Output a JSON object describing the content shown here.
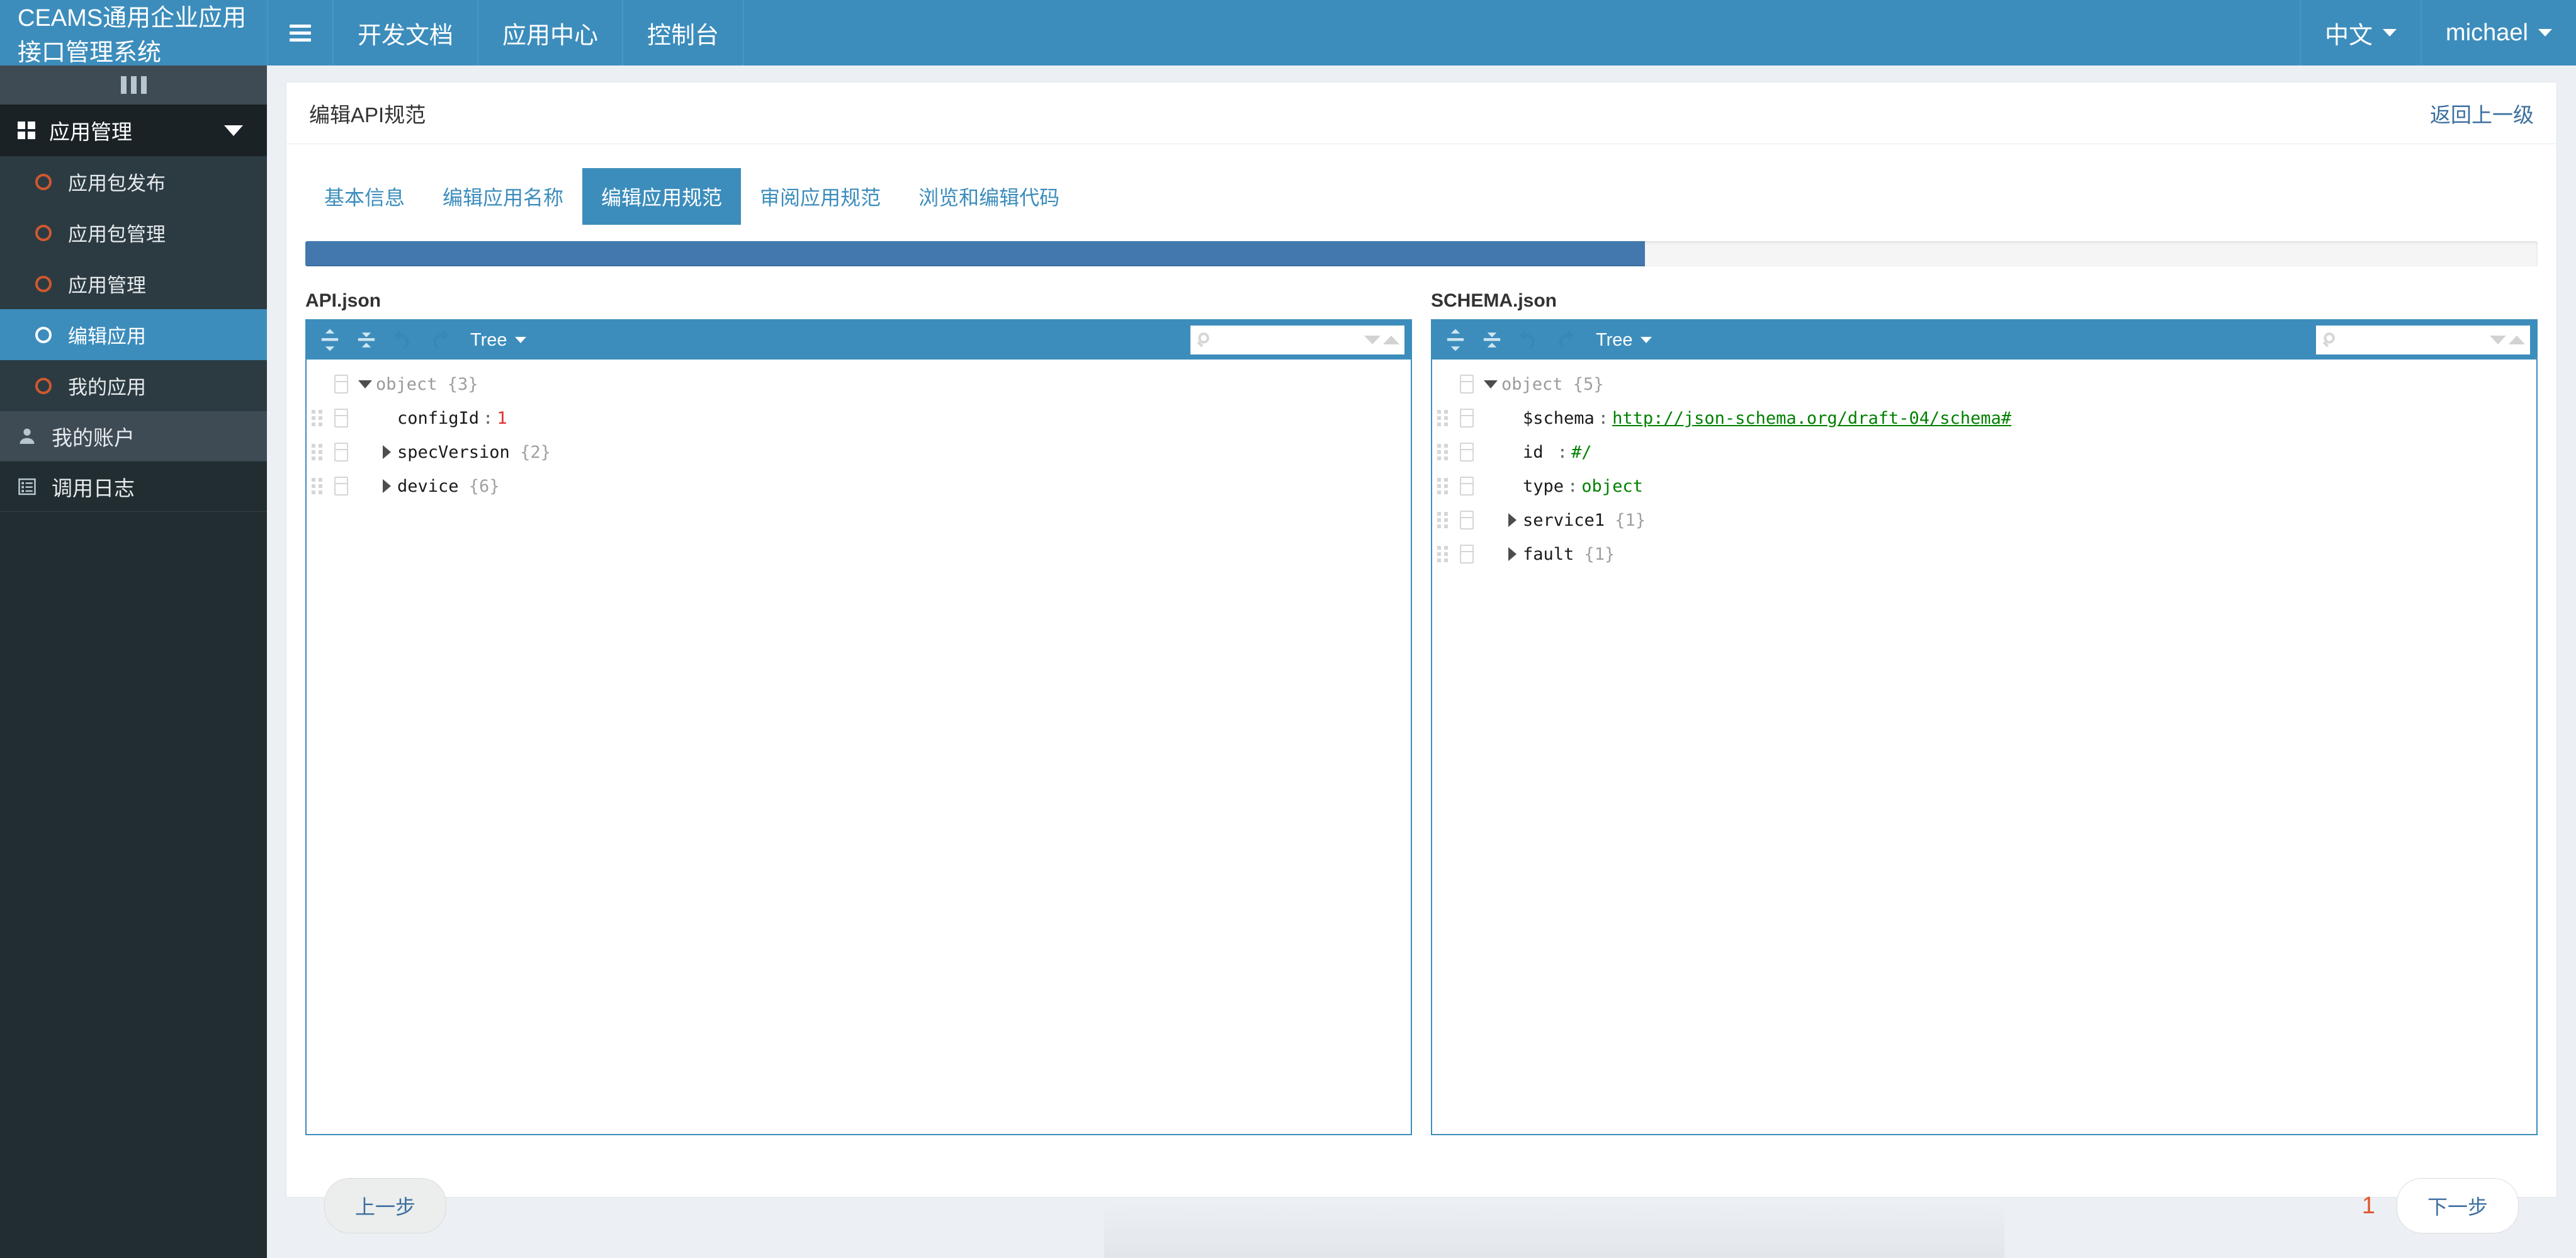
{
  "navbar": {
    "brand": "CEAMS通用企业应用接口管理系统",
    "menu_icon": "hamburger-icon",
    "items": [
      {
        "label": "开发文档"
      },
      {
        "label": "应用中心"
      },
      {
        "label": "控制台"
      }
    ],
    "right": [
      {
        "label": "中文"
      },
      {
        "label": "michael"
      }
    ]
  },
  "sidebar": {
    "toggle_icon": "sidebar-bars-icon",
    "group": {
      "label": "应用管理",
      "icon": "grid-icon",
      "expanded": true,
      "items": [
        {
          "label": "应用包发布",
          "active": false
        },
        {
          "label": "应用包管理",
          "active": false
        },
        {
          "label": "应用管理",
          "active": false
        },
        {
          "label": "编辑应用",
          "active": true
        },
        {
          "label": "我的应用",
          "active": false
        }
      ]
    },
    "items": [
      {
        "label": "我的账户",
        "icon": "user-icon"
      },
      {
        "label": "调用日志",
        "icon": "list-icon"
      }
    ]
  },
  "page": {
    "title": "编辑API规范",
    "back_link": "返回上一级"
  },
  "tabs": [
    {
      "label": "基本信息",
      "active": false
    },
    {
      "label": "编辑应用名称",
      "active": false
    },
    {
      "label": "编辑应用规范",
      "active": true
    },
    {
      "label": "审阅应用规范",
      "active": false
    },
    {
      "label": "浏览和编辑代码",
      "active": false
    }
  ],
  "progress": {
    "percent": 60
  },
  "editors": [
    {
      "title": "API.json",
      "toolbar": {
        "expand_all_icon": "expand-all-icon",
        "collapse_all_icon": "collapse-all-icon",
        "undo_icon": "undo-icon",
        "redo_icon": "redo-icon",
        "mode_label": "Tree",
        "search_placeholder": "",
        "search_value": "",
        "search_icon": "search-icon",
        "next_icon": "triangle-down-icon",
        "prev_icon": "triangle-up-icon"
      },
      "tree": [
        {
          "indent": 0,
          "toggle": "down",
          "key": "object",
          "key_style": "gray",
          "sep": "",
          "value": "",
          "value_style": "",
          "count": "{3}",
          "drag": false
        },
        {
          "indent": 1,
          "toggle": "none",
          "key": "configId",
          "key_style": "key",
          "sep": ":",
          "value": "1",
          "value_style": "num",
          "count": "",
          "drag": true
        },
        {
          "indent": 1,
          "toggle": "right",
          "key": "specVersion",
          "key_style": "key",
          "sep": "",
          "value": "",
          "value_style": "",
          "count": "{2}",
          "drag": true
        },
        {
          "indent": 1,
          "toggle": "right",
          "key": "device",
          "key_style": "key",
          "sep": "",
          "value": "",
          "value_style": "",
          "count": "{6}",
          "drag": true
        }
      ]
    },
    {
      "title": "SCHEMA.json",
      "toolbar": {
        "expand_all_icon": "expand-all-icon",
        "collapse_all_icon": "collapse-all-icon",
        "undo_icon": "undo-icon",
        "redo_icon": "redo-icon",
        "mode_label": "Tree",
        "search_placeholder": "",
        "search_value": "",
        "search_icon": "search-icon",
        "next_icon": "triangle-down-icon",
        "prev_icon": "triangle-up-icon"
      },
      "tree": [
        {
          "indent": 0,
          "toggle": "down",
          "key": "object",
          "key_style": "gray",
          "sep": "",
          "value": "",
          "value_style": "",
          "count": "{5}",
          "drag": false
        },
        {
          "indent": 1,
          "toggle": "none",
          "key": "$schema",
          "key_style": "key",
          "sep": ":",
          "value": "http://json-schema.org/draft-04/schema#",
          "value_style": "link",
          "count": "",
          "drag": true
        },
        {
          "indent": 1,
          "toggle": "none",
          "key": "id ",
          "key_style": "key",
          "sep": ":",
          "value": "#/",
          "value_style": "str",
          "count": "",
          "drag": true
        },
        {
          "indent": 1,
          "toggle": "none",
          "key": "type",
          "key_style": "key",
          "sep": ":",
          "value": "object",
          "value_style": "str",
          "count": "",
          "drag": true
        },
        {
          "indent": 1,
          "toggle": "right",
          "key": "service1",
          "key_style": "key",
          "sep": "",
          "value": "",
          "value_style": "",
          "count": "{1}",
          "drag": true
        },
        {
          "indent": 1,
          "toggle": "right",
          "key": "fault",
          "key_style": "key",
          "sep": "",
          "value": "",
          "value_style": "",
          "count": "{1}",
          "drag": true
        }
      ]
    }
  ],
  "footer": {
    "prev_label": "上一步",
    "next_label": "下一步",
    "page_number": "1"
  },
  "colors": {
    "brand_blue": "#3c8dbc",
    "sidebar_dark": "#222d32",
    "progress_fill": "#4278ad",
    "accent_orange": "#e0572c",
    "link_blue": "#3c6fa0"
  }
}
